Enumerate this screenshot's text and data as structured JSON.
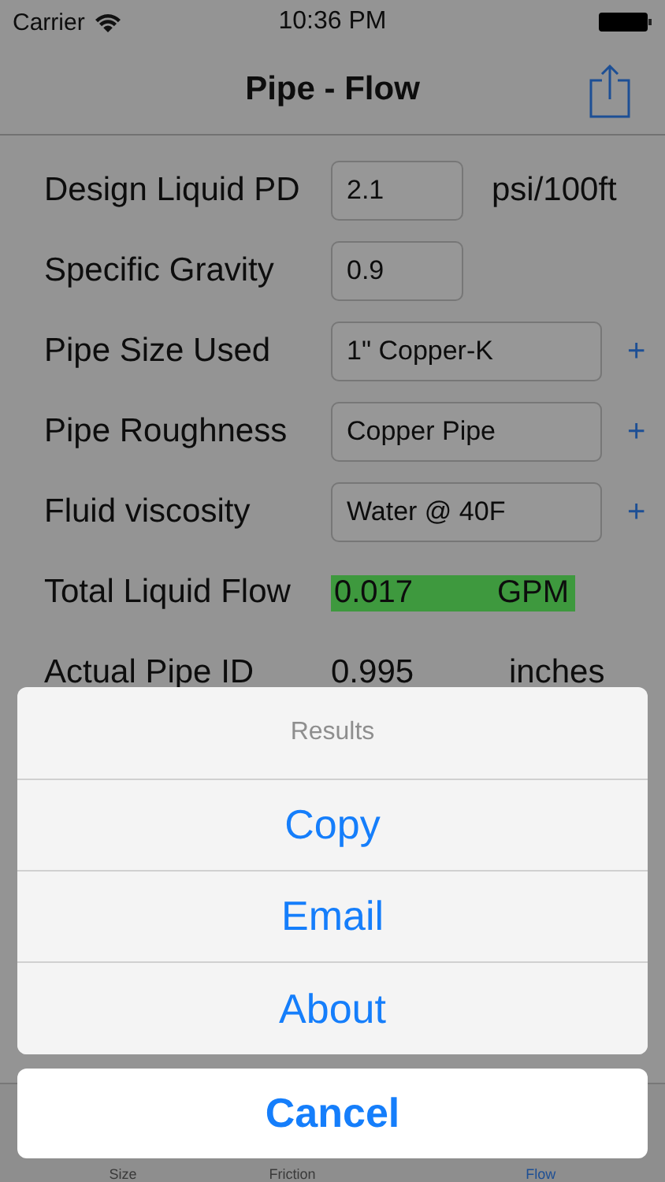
{
  "status_bar": {
    "carrier": "Carrier",
    "time": "10:36 PM"
  },
  "nav": {
    "title": "Pipe - Flow"
  },
  "rows": [
    {
      "kind": "short-field",
      "label": "Design Liquid PD",
      "value": "2.1",
      "unit": "psi/100ft"
    },
    {
      "kind": "short-field",
      "label": "Specific Gravity",
      "value": "0.9"
    },
    {
      "kind": "picker",
      "label": "Pipe Size Used",
      "value": "1\" Copper-K",
      "plus": "+"
    },
    {
      "kind": "picker",
      "label": "Pipe Roughness",
      "value": "Copper Pipe",
      "plus": "+"
    },
    {
      "kind": "picker",
      "label": "Fluid viscosity",
      "value": "Water @ 40F",
      "plus": "+"
    },
    {
      "kind": "result",
      "label": "Total Liquid Flow",
      "value": "0.017",
      "unit": "GPM"
    },
    {
      "kind": "readout",
      "label": "Actual Pipe ID",
      "value": "0.995",
      "unit": "inches"
    }
  ],
  "tabs": [
    {
      "label": "Size",
      "selected": false
    },
    {
      "label": "Friction",
      "selected": false
    },
    {
      "label": "Flow",
      "selected": true
    }
  ],
  "action_sheet": {
    "title": "Results",
    "actions": [
      "Copy",
      "Email",
      "About"
    ],
    "cancel": "Cancel"
  }
}
